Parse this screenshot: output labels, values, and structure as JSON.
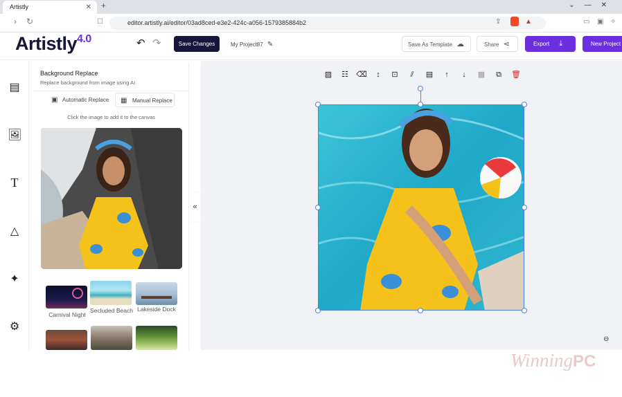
{
  "browser": {
    "tab_title": "Artistly",
    "url": "editor.artistly.ai/editor/03ad8ced-e3e2-424c-a056-1579385884b2"
  },
  "header": {
    "logo_text": "Artistly",
    "logo_version": "4.0",
    "save_changes_label": "Save Changes",
    "project_name": "My Project87",
    "save_template_label": "Save As Template",
    "share_label": "Share",
    "export_label": "Export",
    "new_project_label": "New Project"
  },
  "panel": {
    "title": "Background Replace",
    "subtitle": "Replace background from image using AI",
    "tab_auto": "Automatic Replace",
    "tab_manual": "Manual Replace",
    "hint": "Click the image to add it to the canvas",
    "thumbnails": [
      {
        "label": "Carnival Night"
      },
      {
        "label": "Secluded Beach"
      },
      {
        "label": "Lakeside Dock"
      }
    ]
  },
  "watermark": {
    "text": "Winning",
    "suffix": "PC"
  },
  "colors": {
    "accent": "#6b2fe0",
    "dark": "#16163a",
    "selection": "#4f7fe0"
  }
}
